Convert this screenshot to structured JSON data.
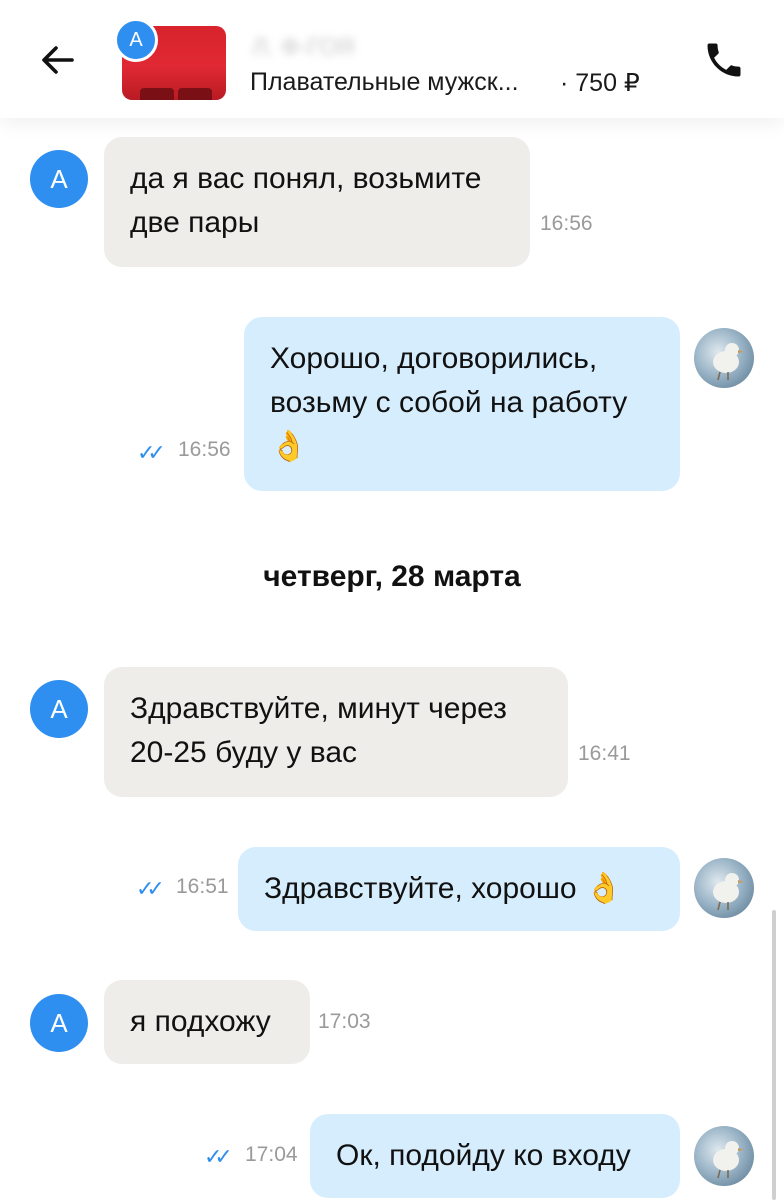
{
  "header": {
    "seller_avatar_letter": "A",
    "seller_name": "Л. Ф-ГОЯ",
    "product_title": "Плавательные мужск...",
    "product_price": "· 750 ₽",
    "icons": [
      "back-arrow-icon",
      "phone-icon"
    ]
  },
  "date_separator": "четверг, 28 марта",
  "messages": [
    {
      "from": "seller",
      "avatar": "A",
      "lines": [
        "да я вас понял, возьмите",
        "две пары"
      ],
      "time": "16:56"
    },
    {
      "from": "me",
      "lines": [
        "Хорошо, договорились,",
        "возьму с собой на работу"
      ],
      "emoji": "👌",
      "time": "16:56",
      "read": true
    },
    {
      "from": "seller",
      "avatar": "A",
      "lines": [
        "Здравствуйте, минут через",
        "20-25 буду у вас"
      ],
      "time": "16:41"
    },
    {
      "from": "me",
      "lines": [
        "Здравствуйте, хорошо"
      ],
      "emoji": "👌",
      "time": "16:51",
      "read": true
    },
    {
      "from": "seller",
      "avatar": "A",
      "lines": [
        "я подхожу"
      ],
      "time": "17:03"
    },
    {
      "from": "me",
      "lines": [
        "Ок, подойду ко входу"
      ],
      "time": "17:04",
      "read": true
    }
  ],
  "colors": {
    "accent": "#2f8ff0",
    "incoming_bubble": "#efedea",
    "outgoing_bubble": "#d6edfd",
    "timestamp": "#9a9a9a"
  }
}
